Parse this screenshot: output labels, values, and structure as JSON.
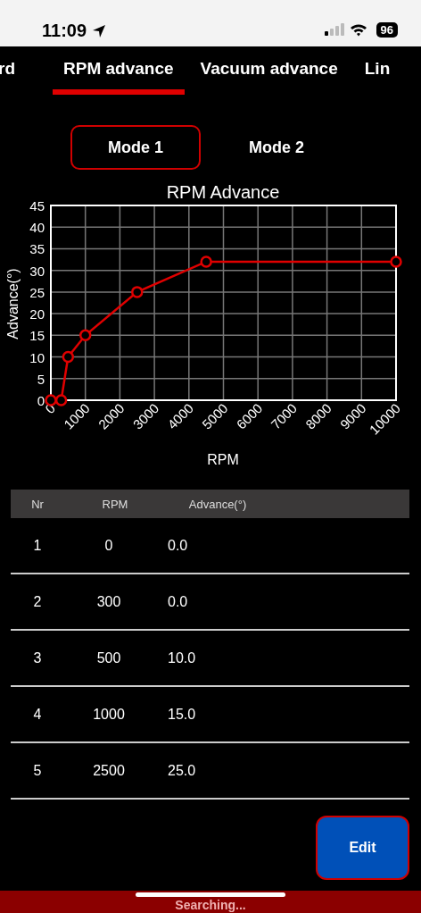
{
  "status_bar": {
    "time": "11:09",
    "battery": "96"
  },
  "tabs": [
    {
      "label": "rd",
      "selected": false
    },
    {
      "label": "RPM advance",
      "selected": true
    },
    {
      "label": "Vacuum advance",
      "selected": false
    },
    {
      "label": "Lin",
      "selected": false
    }
  ],
  "modes": [
    {
      "label": "Mode 1",
      "selected": true
    },
    {
      "label": "Mode 2",
      "selected": false
    }
  ],
  "chart": {
    "chart_data": {
      "type": "line",
      "title": "RPM Advance",
      "xlabel": "RPM",
      "ylabel": "Advance(°)",
      "x": [
        0,
        300,
        500,
        1000,
        2500,
        4500,
        10000
      ],
      "series": [
        {
          "color": "#e00000",
          "marker": "circle",
          "values": [
            0,
            0,
            10,
            15,
            25,
            32,
            32
          ]
        }
      ],
      "grid": true,
      "xlim": [
        0,
        10000
      ],
      "ylim": [
        0,
        45
      ],
      "xticks": [
        0,
        1000,
        2000,
        3000,
        4000,
        5000,
        6000,
        7000,
        8000,
        9000,
        10000
      ],
      "yticks": [
        0,
        5,
        10,
        15,
        20,
        25,
        30,
        35,
        40,
        45
      ]
    }
  },
  "table": {
    "columns": [
      "Nr",
      "RPM",
      "Advance(°)"
    ],
    "rows": [
      [
        "1",
        "0",
        "0.0"
      ],
      [
        "2",
        "300",
        "0.0"
      ],
      [
        "3",
        "500",
        "10.0"
      ],
      [
        "4",
        "1000",
        "15.0"
      ],
      [
        "5",
        "2500",
        "25.0"
      ]
    ]
  },
  "edit_button": "Edit",
  "connection_bar": {
    "text": "Searching..."
  }
}
